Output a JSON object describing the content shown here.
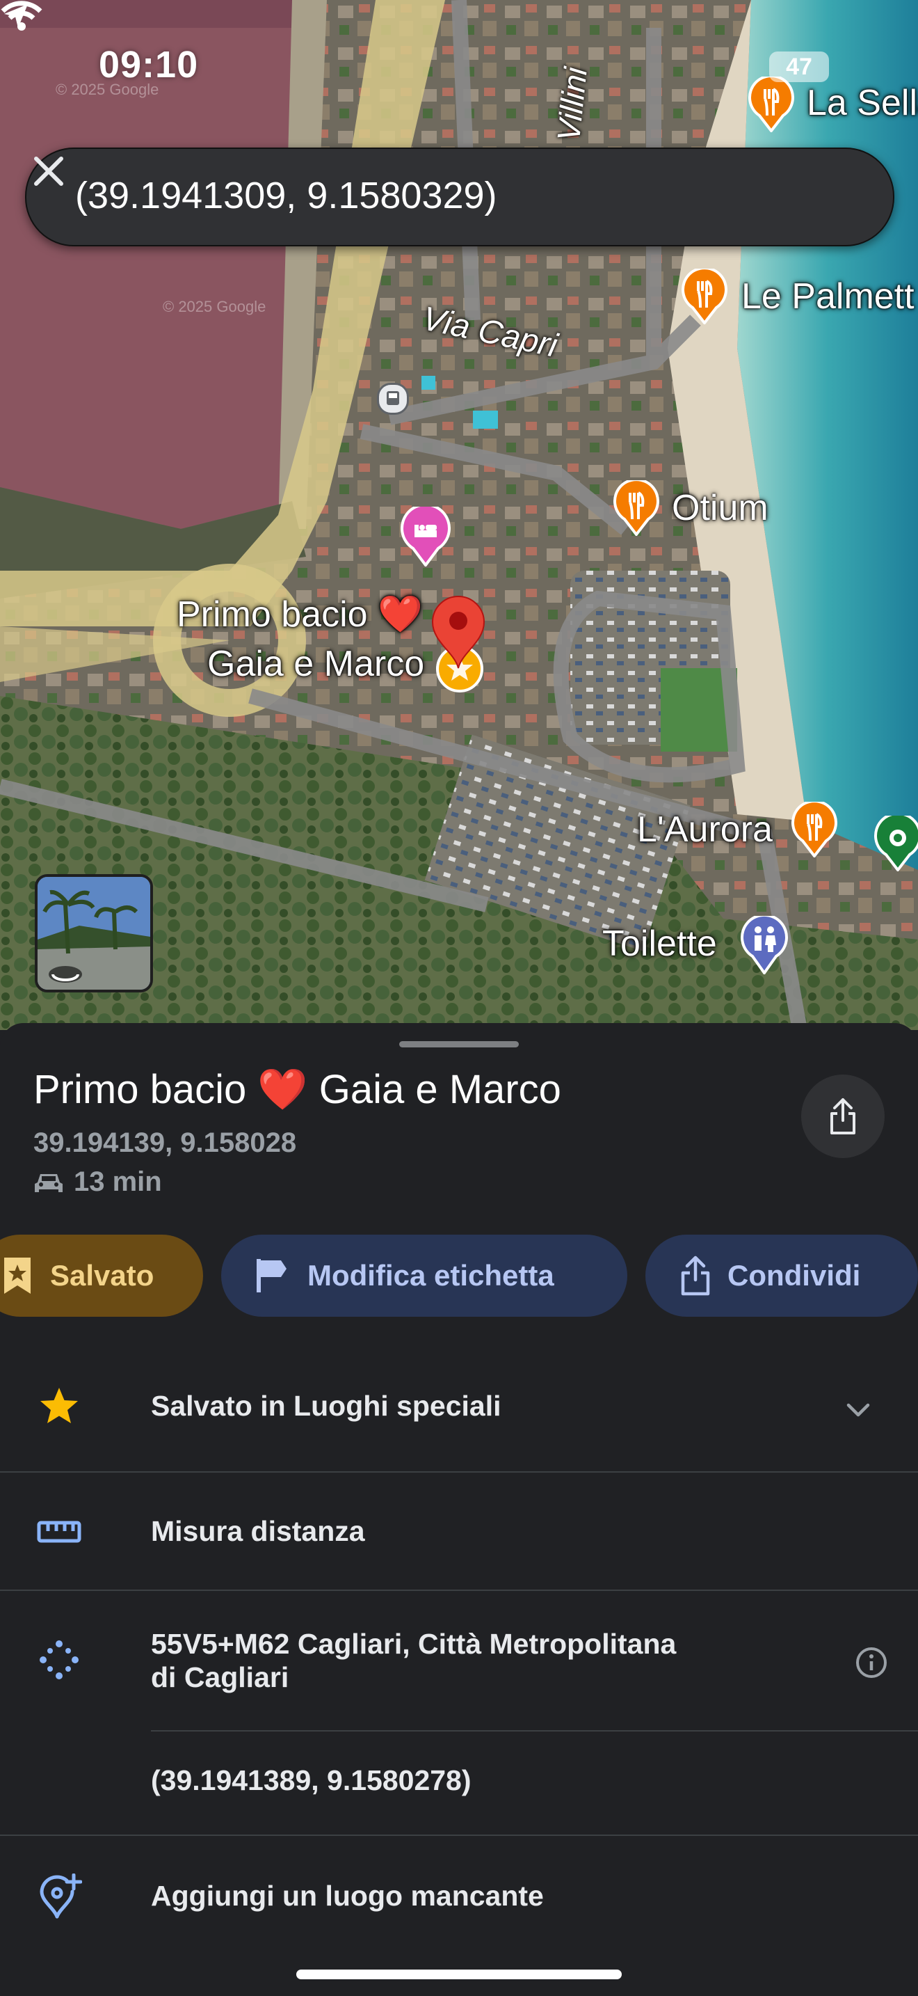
{
  "status_bar": {
    "time": "09:10",
    "battery": "47"
  },
  "search": {
    "query": "(39.1941309, 9.1580329)"
  },
  "map": {
    "street_labels": [
      "Via Capri",
      "Villini"
    ],
    "pois": [
      "La Sella",
      "Le Palmett",
      "Otium",
      "L'Aurora",
      "Toilette"
    ],
    "pin_label_line1": "Primo bacio ❤️",
    "pin_label_line2": "Gaia e Marco",
    "watermarks": [
      "© 2025 Google",
      "© 2025 Google"
    ]
  },
  "place": {
    "title": "Primo bacio",
    "heart": "❤️",
    "title_tail": "Gaia e Marco",
    "coordinates": "39.194139, 9.158028",
    "travel_time": "13 min"
  },
  "actions": {
    "saved": "Salvato",
    "edit_label": "Modifica etichetta",
    "share": "Condividi"
  },
  "details": {
    "saved_in": "Salvato in Luoghi speciali",
    "measure": "Misura distanza",
    "plus_code_line1": "55V5+M62 Cagliari, Città Metropolitana",
    "plus_code_line2": "di Cagliari",
    "exact_coords": "(39.1941389, 9.1580278)",
    "add_place": "Aggiungi un luogo mancante"
  },
  "colors": {
    "accent_blue": "#8ab4f8",
    "saved_chip": "#6a4b14",
    "action_chip": "#283555",
    "pin_red": "#ea4335",
    "poi_orange": "#f57c00"
  }
}
